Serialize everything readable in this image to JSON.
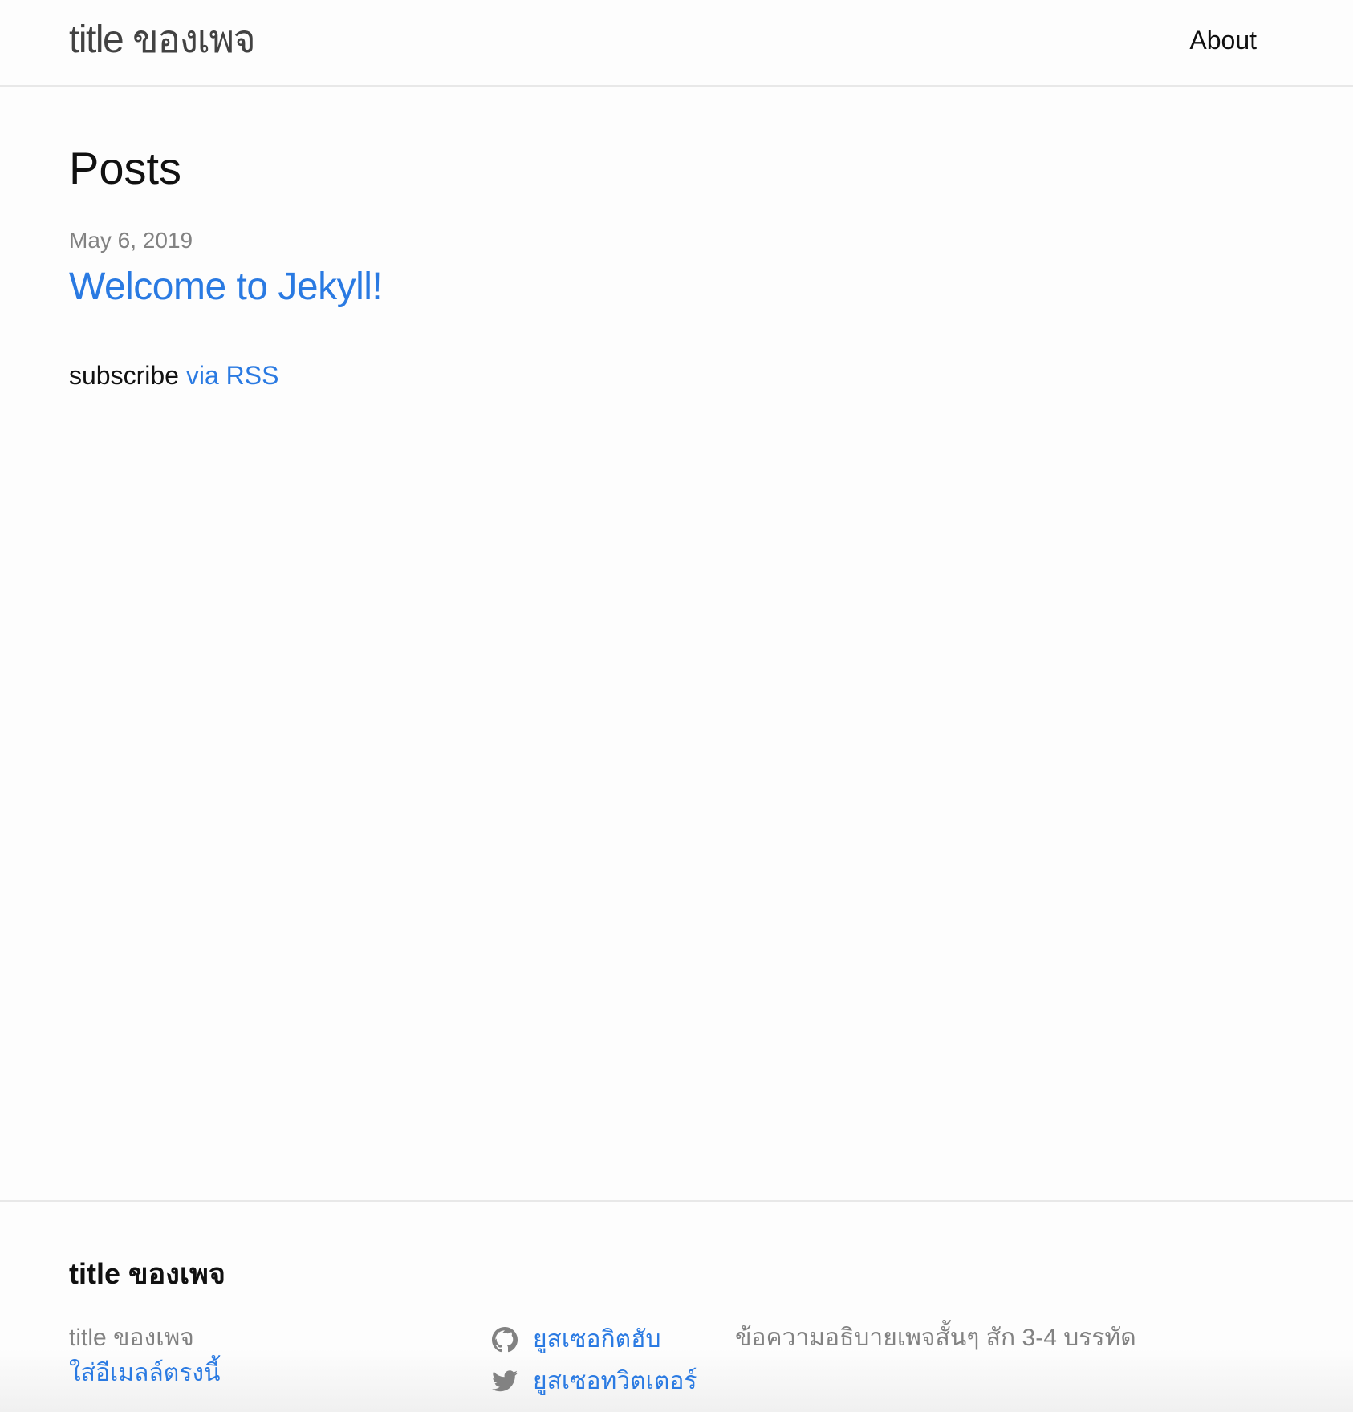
{
  "header": {
    "site_title": "title ของเพจ",
    "nav": [
      {
        "label": "About"
      }
    ]
  },
  "main": {
    "heading": "Posts",
    "posts": [
      {
        "date": "May 6, 2019",
        "title": "Welcome to Jekyll!"
      }
    ],
    "subscribe": {
      "prefix": "subscribe",
      "link_label": "via RSS"
    }
  },
  "footer": {
    "heading": "title ของเพจ",
    "name": "title ของเพจ",
    "email_label": "ใส่อีเมลล์ตรงนี้",
    "social": [
      {
        "icon": "github-icon",
        "label": "ยูสเซอกิตฮับ"
      },
      {
        "icon": "twitter-icon",
        "label": "ยูสเซอทวิตเตอร์"
      }
    ],
    "description": "ข้อความอธิบายเพจสั้นๆ สัก 3-4 บรรทัด"
  },
  "colors": {
    "link": "#2a7ae2",
    "muted": "#828282",
    "text": "#111111",
    "border": "#e8e8e8"
  }
}
